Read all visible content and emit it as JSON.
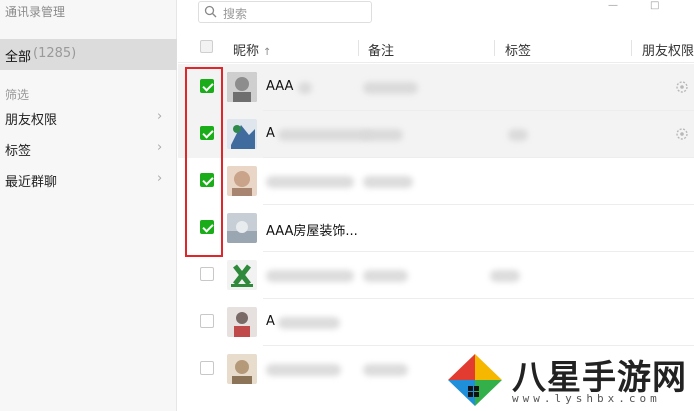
{
  "sidebar": {
    "title": "通讯录管理",
    "all_label": "全部",
    "all_count": "(1285)",
    "filter_label": "筛选",
    "items": [
      {
        "label": "朋友权限",
        "chevron": "›"
      },
      {
        "label": "标签",
        "chevron": "›"
      },
      {
        "label": "最近群聊",
        "chevron": "›"
      }
    ]
  },
  "search": {
    "placeholder": "搜索"
  },
  "window_controls": {
    "minimize": "—",
    "maximize": "□"
  },
  "table": {
    "columns": [
      "昵称",
      "备注",
      "标签",
      "朋友权限"
    ],
    "sort_indicator": "↑",
    "rows": [
      {
        "name": "AAA",
        "checked": true,
        "avatar_color": "#8d8d8d"
      },
      {
        "name": "A",
        "checked": true,
        "avatar_color": "#3f6b9e"
      },
      {
        "name": "",
        "checked": true,
        "avatar_color": "#c9a38a"
      },
      {
        "name": "AAA房屋装饰...",
        "checked": true,
        "avatar_color": "#9aa6b2"
      },
      {
        "name": "",
        "checked": false,
        "avatar_color": "#2f8a3b"
      },
      {
        "name": "A",
        "checked": false,
        "avatar_color": "#7a6a66"
      },
      {
        "name": "",
        "checked": false,
        "avatar_color": "#b59a7a"
      }
    ]
  },
  "watermark": {
    "brand": "八星手游网",
    "url": "www.lyshbx.com"
  }
}
